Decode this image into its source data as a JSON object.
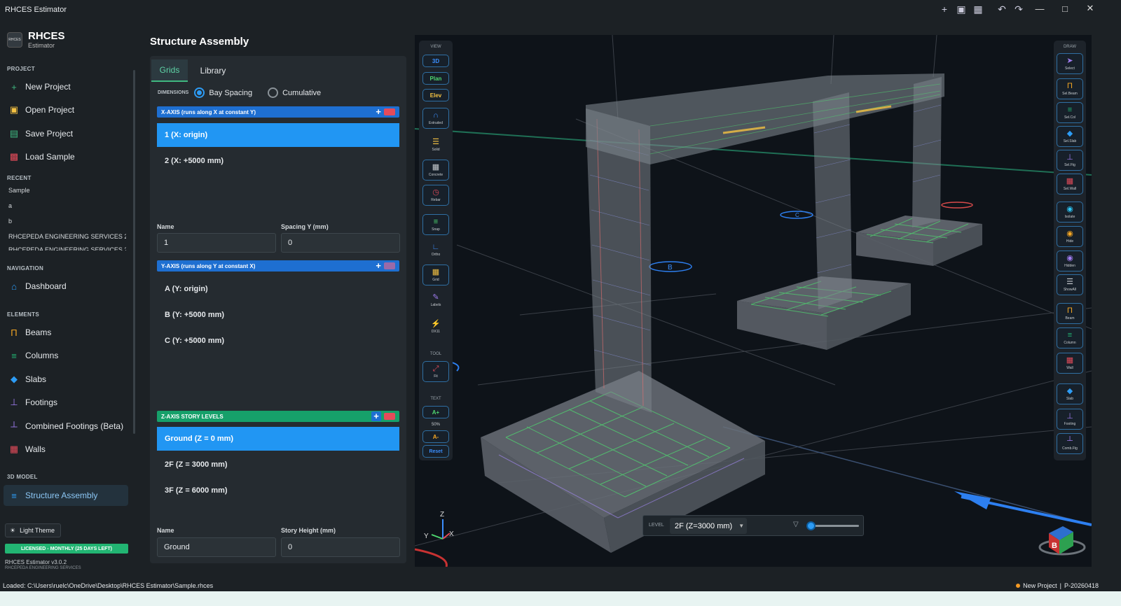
{
  "window": {
    "title": "RHCES Estimator",
    "controls": [
      "minimize-icon",
      "maximize-icon",
      "close-icon"
    ],
    "toolbar_icons": [
      "new-icon",
      "file-icon",
      "save-icon",
      "undo-icon",
      "redo-icon"
    ]
  },
  "sidebar": {
    "brand": {
      "name": "RHCES",
      "subtitle": "Estimator",
      "logo_text": "RHCES"
    },
    "project_header": "PROJECT",
    "project_items": [
      {
        "label": "New Project",
        "icon": "plus-icon"
      },
      {
        "label": "Open Project",
        "icon": "folder-icon"
      },
      {
        "label": "Save Project",
        "icon": "save-icon"
      },
      {
        "label": "Load Sample",
        "icon": "book-icon"
      }
    ],
    "recent_header": "RECENT",
    "recent_items": [
      "Sample",
      "a",
      "b",
      "RHCEPEDA ENGINEERING SERVICES 2-...",
      "RHCEPEDA ENGINEERING SERVICES 2-..."
    ],
    "navigation_header": "NAVIGATION",
    "navigation_items": [
      {
        "label": "Dashboard",
        "icon": "home-icon"
      }
    ],
    "elements_header": "ELEMENTS",
    "elements_items": [
      {
        "label": "Beams",
        "icon": "beam-icon"
      },
      {
        "label": "Columns",
        "icon": "column-icon"
      },
      {
        "label": "Slabs",
        "icon": "slab-icon"
      },
      {
        "label": "Footings",
        "icon": "footing-icon"
      },
      {
        "label": "Combined Footings (Beta)",
        "icon": "combined-footing-icon"
      },
      {
        "label": "Walls",
        "icon": "wall-icon"
      }
    ],
    "model_header": "3D MODEL",
    "model_items": [
      {
        "label": "Structure Assembly",
        "icon": "assembly-icon",
        "active": true
      }
    ],
    "theme_button": "Light Theme",
    "license": "LICENSED - MONTHLY (25 DAYS LEFT)",
    "version": "RHCES Estimator v3.0.2",
    "company": "RHCEPEDA ENGINEERING SERVICES"
  },
  "panel": {
    "title": "Structure Assembly",
    "tabs": [
      {
        "label": "Grids",
        "active": true
      },
      {
        "label": "Library",
        "active": false
      }
    ],
    "dimensions_label": "DIMENSIONS",
    "dimension_options": [
      {
        "label": "Bay Spacing",
        "selected": true
      },
      {
        "label": "Cumulative",
        "selected": false
      }
    ],
    "x_axis": {
      "header": "X-AXIS  (runs along X at constant Y)",
      "rows": [
        {
          "label": "1  (X: origin)",
          "selected": true
        },
        {
          "label": "2  (X: +5000 mm)",
          "selected": false
        }
      ],
      "name_label": "Name",
      "name_value": "1",
      "spacing_label": "Spacing Y (mm)",
      "spacing_value": "0"
    },
    "y_axis": {
      "header": "Y-AXIS  (runs along Y at constant X)",
      "rows": [
        {
          "label": "A  (Y: origin)"
        },
        {
          "label": "B  (Y: +5000 mm)"
        },
        {
          "label": "C  (Y: +5000 mm)"
        }
      ]
    },
    "z_axis": {
      "header": "Z-AXIS  STORY LEVELS",
      "rows": [
        {
          "label": "Ground  (Z = 0 mm)",
          "selected": true
        },
        {
          "label": "2F  (Z = 3000 mm)",
          "selected": false
        },
        {
          "label": "3F  (Z = 6000 mm)",
          "selected": false
        }
      ],
      "name_label": "Name",
      "name_value": "Ground",
      "height_label": "Story Height (mm)",
      "height_value": "0"
    }
  },
  "viewport": {
    "view_group": "VIEW",
    "view_buttons": [
      "3D",
      "Plan",
      "Elev"
    ],
    "view_tools": [
      {
        "label": "Extruded",
        "icon": "extruded-icon"
      },
      {
        "label": "Solid",
        "icon": "solid-icon"
      },
      {
        "label": "Concrete",
        "icon": "concrete-icon"
      },
      {
        "label": "Rebar",
        "icon": "rebar-icon"
      },
      {
        "label": "Snap",
        "icon": "snap-icon"
      },
      {
        "label": "Ortho",
        "icon": "ortho-icon"
      },
      {
        "label": "Grid",
        "icon": "grid-icon"
      },
      {
        "label": "Labels",
        "icon": "labels-icon"
      },
      {
        "label": "DX11",
        "icon": "dx11-icon"
      }
    ],
    "tool_group": "TOOL",
    "tool_fit": "Fit",
    "text_group": "TEXT",
    "text_increase": "A+",
    "text_percent": "50%",
    "text_decrease": "A-",
    "text_reset": "Reset",
    "draw_group": "DRAW",
    "draw_tools": [
      {
        "label": "Select",
        "icon": "cursor-icon"
      },
      {
        "label": "Sel.Beam",
        "icon": "select-beam-icon"
      },
      {
        "label": "Sel.Col",
        "icon": "select-column-icon"
      },
      {
        "label": "Sel.Slab",
        "icon": "select-slab-icon"
      },
      {
        "label": "Sel.Ftg",
        "icon": "select-footing-icon"
      },
      {
        "label": "Sel.Wall",
        "icon": "select-wall-icon"
      },
      {
        "label": "Isolate",
        "icon": "isolate-icon"
      },
      {
        "label": "Hide",
        "icon": "hide-icon"
      },
      {
        "label": "Hidden",
        "icon": "hidden-icon"
      },
      {
        "label": "ShowAll",
        "icon": "show-all-icon"
      },
      {
        "label": "Beam",
        "icon": "beam-icon"
      },
      {
        "label": "Column",
        "icon": "column-icon"
      },
      {
        "label": "Wall",
        "icon": "wall-icon"
      },
      {
        "label": "Slab",
        "icon": "slab-icon"
      },
      {
        "label": "Footing",
        "icon": "footing-icon"
      },
      {
        "label": "Comb.Ftg",
        "icon": "combined-footing-icon"
      }
    ],
    "grid_labels": [
      "B",
      "C"
    ],
    "axis_labels": {
      "z": "Z",
      "x": "X",
      "y": "Y"
    },
    "view_cube_label": "B",
    "level_label": "LEVEL",
    "level_value": "2F (Z=3000 mm)",
    "level_slider": 0.05
  },
  "status": {
    "loaded": "Loaded: C:\\Users\\ruelc\\OneDrive\\Desktop\\RHCES Estimator\\Sample.rhces",
    "project": "New Project",
    "project_id": "P-20260418"
  },
  "colors": {
    "accent_blue": "#2196f3",
    "x_axis_bar": "#1e6fd1",
    "z_axis_bar": "#16a06a",
    "license_green": "#22b573",
    "viewport_bg": "#0e1319"
  }
}
